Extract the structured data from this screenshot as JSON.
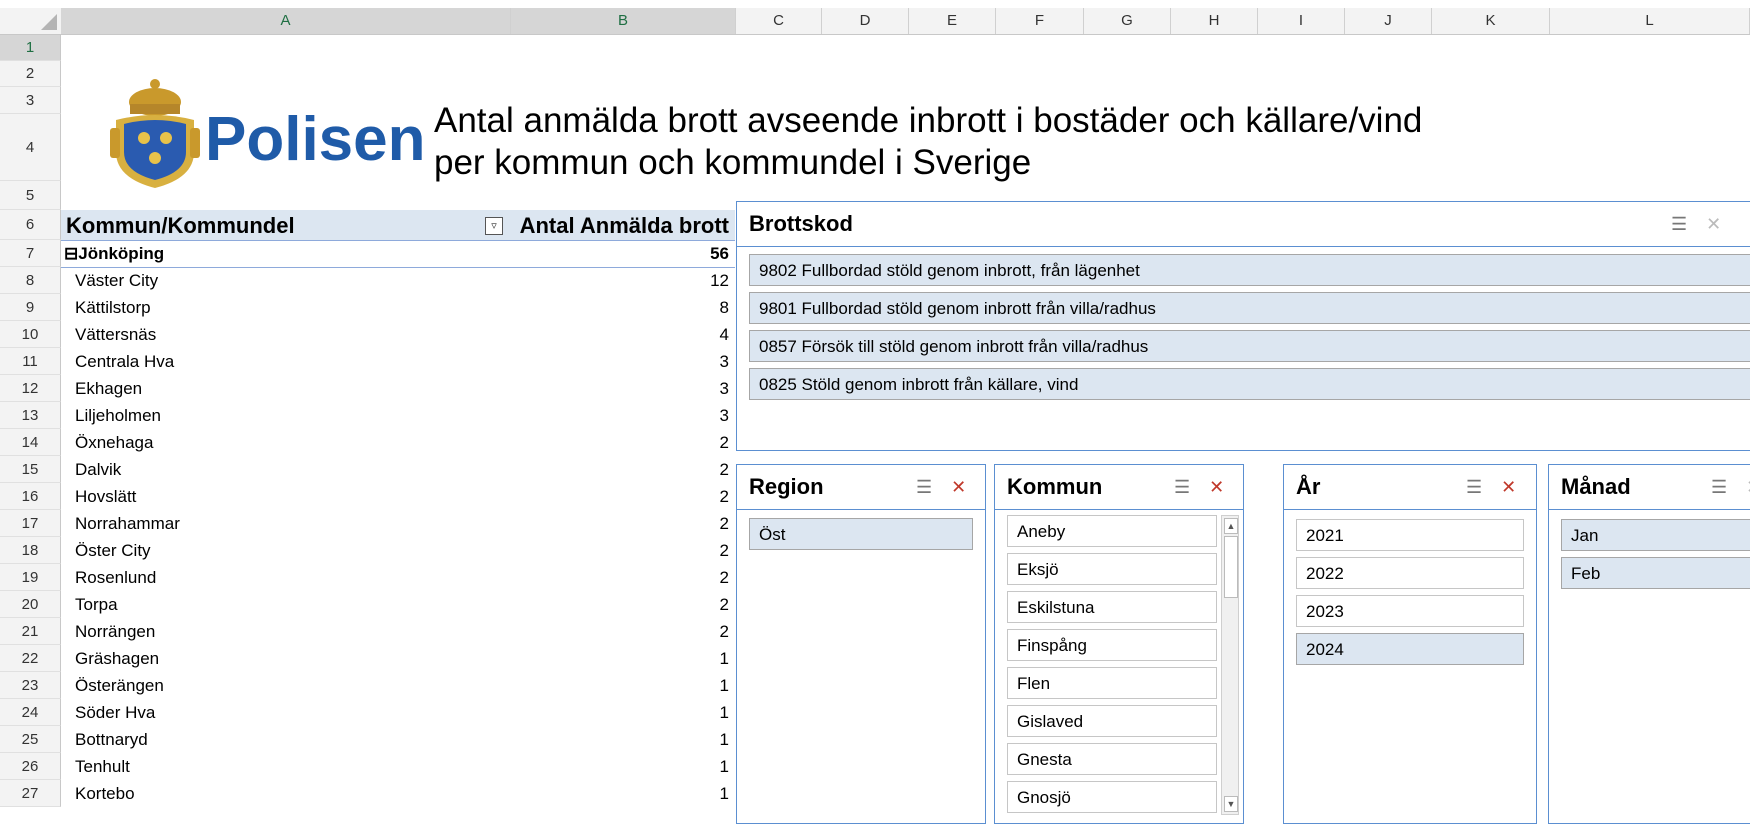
{
  "columns": [
    "A",
    "B",
    "C",
    "D",
    "E",
    "F",
    "G",
    "H",
    "I",
    "J",
    "K",
    "L"
  ],
  "rows": [
    "1",
    "2",
    "3",
    "4",
    "5",
    "6",
    "7",
    "8",
    "9",
    "10",
    "11",
    "12",
    "13",
    "14",
    "15",
    "16",
    "17",
    "18",
    "19",
    "20",
    "21",
    "22",
    "23",
    "24",
    "25",
    "26",
    "27"
  ],
  "header": {
    "logo_text": "Polisen",
    "title_line1": "Antal anmälda brott avseende inbrott i bostäder och källare/vind",
    "title_line2": "per kommun och kommundel i Sverige"
  },
  "pivot": {
    "col1_header": "Kommun/Kommundel",
    "col2_header": "Antal Anmälda brott",
    "group": {
      "label": "Jönköping",
      "value": "56",
      "expander": "⊟"
    },
    "items": [
      {
        "label": "Väster City",
        "value": "12"
      },
      {
        "label": "Kättilstorp",
        "value": "8"
      },
      {
        "label": "Vättersnäs",
        "value": "4"
      },
      {
        "label": "Centrala Hva",
        "value": "3"
      },
      {
        "label": "Ekhagen",
        "value": "3"
      },
      {
        "label": "Liljeholmen",
        "value": "3"
      },
      {
        "label": "Öxnehaga",
        "value": "2"
      },
      {
        "label": "Dalvik",
        "value": "2"
      },
      {
        "label": "Hovslätt",
        "value": "2"
      },
      {
        "label": "Norrahammar",
        "value": "2"
      },
      {
        "label": "Öster City",
        "value": "2"
      },
      {
        "label": "Rosenlund",
        "value": "2"
      },
      {
        "label": "Torpa",
        "value": "2"
      },
      {
        "label": "Norrängen",
        "value": "2"
      },
      {
        "label": "Gräshagen",
        "value": "1"
      },
      {
        "label": "Österängen",
        "value": "1"
      },
      {
        "label": "Söder Hva",
        "value": "1"
      },
      {
        "label": "Bottnaryd",
        "value": "1"
      },
      {
        "label": "Tenhult",
        "value": "1"
      },
      {
        "label": "Kortebo",
        "value": "1"
      }
    ]
  },
  "slicers": {
    "brottskod": {
      "title": "Brottskod",
      "items": [
        "9802 Fullbordad stöld genom inbrott, från lägenhet",
        "9801 Fullbordad stöld genom inbrott från villa/radhus",
        "0857 Försök till stöld genom inbrott från villa/radhus",
        "0825 Stöld genom inbrott från källare, vind"
      ]
    },
    "region": {
      "title": "Region",
      "items": [
        "Öst"
      ]
    },
    "kommun": {
      "title": "Kommun",
      "items": [
        "Aneby",
        "Eksjö",
        "Eskilstuna",
        "Finspång",
        "Flen",
        "Gislaved",
        "Gnesta",
        "Gnosjö"
      ]
    },
    "ar": {
      "title": "År",
      "items": [
        "2021",
        "2022",
        "2023",
        "2024"
      ],
      "selected": "2024"
    },
    "manad": {
      "title": "Månad",
      "items": [
        "Jan",
        "Feb"
      ]
    }
  },
  "icons": {
    "multiselect": "☰",
    "clear_filter": "✕"
  }
}
